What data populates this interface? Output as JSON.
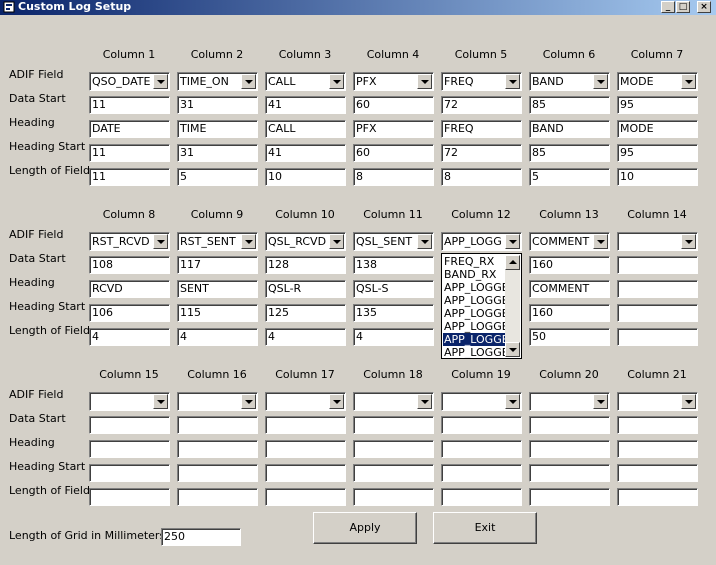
{
  "window": {
    "title": "Custom Log Setup"
  },
  "row_labels": [
    "ADIF Field",
    "Data Start",
    "Heading",
    "Heading Start",
    "Length of Field"
  ],
  "groups": [
    {
      "columns": [
        "Column 1",
        "Column 2",
        "Column 3",
        "Column 4",
        "Column 5",
        "Column 6",
        "Column 7"
      ],
      "adif": [
        "QSO_DATE",
        "TIME_ON",
        "CALL",
        "PFX",
        "FREQ",
        "BAND",
        "MODE"
      ],
      "data_start": [
        "11",
        "31",
        "41",
        "60",
        "72",
        "85",
        "95"
      ],
      "heading": [
        "DATE",
        "TIME",
        "CALL",
        "PFX",
        "FREQ",
        "BAND",
        "MODE"
      ],
      "heading_start": [
        "11",
        "31",
        "41",
        "60",
        "72",
        "85",
        "95"
      ],
      "length": [
        "11",
        "5",
        "10",
        "8",
        "8",
        "5",
        "10"
      ]
    },
    {
      "columns": [
        "Column 8",
        "Column 9",
        "Column 10",
        "Column 11",
        "Column 12",
        "Column 13",
        "Column 14"
      ],
      "adif": [
        "RST_RCVD",
        "RST_SENT",
        "QSL_RCVD",
        "QSL_SENT",
        "APP_LOGG",
        "COMMENT",
        ""
      ],
      "data_start": [
        "108",
        "117",
        "128",
        "138",
        "",
        "160",
        ""
      ],
      "heading": [
        "RCVD",
        "SENT",
        "QSL-R",
        "QSL-S",
        "",
        "COMMENT",
        ""
      ],
      "heading_start": [
        "106",
        "115",
        "125",
        "135",
        "",
        "160",
        ""
      ],
      "length": [
        "4",
        "4",
        "4",
        "4",
        "",
        "50",
        ""
      ]
    },
    {
      "columns": [
        "Column 15",
        "Column 16",
        "Column 17",
        "Column 18",
        "Column 19",
        "Column 20",
        "Column 21"
      ],
      "adif": [
        "",
        "",
        "",
        "",
        "",
        "",
        ""
      ],
      "data_start": [
        "",
        "",
        "",
        "",
        "",
        "",
        ""
      ],
      "heading": [
        "",
        "",
        "",
        "",
        "",
        "",
        ""
      ],
      "heading_start": [
        "",
        "",
        "",
        "",
        "",
        "",
        ""
      ],
      "length": [
        "",
        "",
        "",
        "",
        "",
        "",
        ""
      ]
    }
  ],
  "dropdown": {
    "items": [
      "FREQ_RX",
      "BAND_RX",
      "APP_LOGGE",
      "APP_LOGGE",
      "APP_LOGGE",
      "APP_LOGGE",
      "APP_LOGGE",
      "APP_LOGGE"
    ],
    "selected_index": 6
  },
  "grid_length": {
    "label": "Length of Grid in Millimeters:",
    "value": "250"
  },
  "buttons": {
    "apply": "Apply",
    "exit": "Exit"
  },
  "titlebar_buttons": {
    "minimize": "_",
    "maximize": "□",
    "close": "×"
  },
  "colors": {
    "titlebar_start": "#0a246a",
    "titlebar_end": "#a6caf0",
    "face": "#d4d0c8",
    "selection": "#0a246a"
  }
}
